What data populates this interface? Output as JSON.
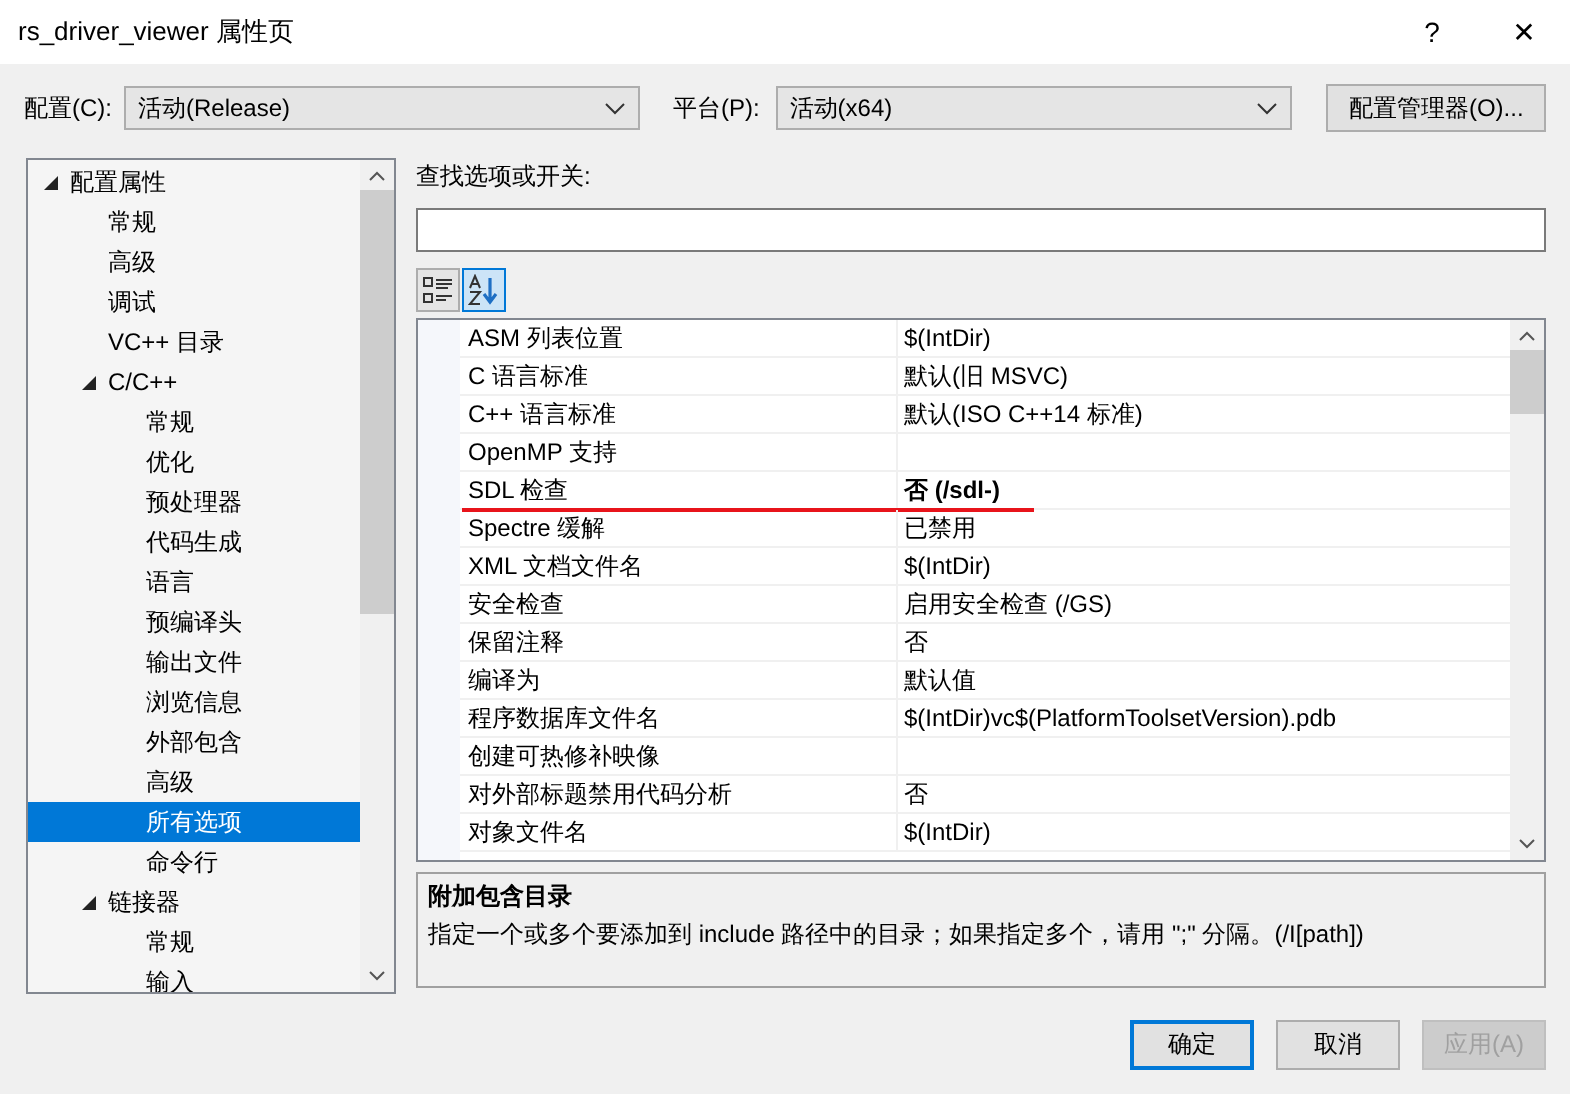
{
  "window": {
    "title": "rs_driver_viewer 属性页",
    "help": "?",
    "close": "✕"
  },
  "config": {
    "label": "配置(C):",
    "value": "活动(Release)"
  },
  "platform": {
    "label": "平台(P):",
    "value": "活动(x64)"
  },
  "config_manager": "配置管理器(O)...",
  "tree": [
    {
      "label": "配置属性",
      "expanded": true,
      "selected": false,
      "children": [
        {
          "label": "常规",
          "selected": false
        },
        {
          "label": "高级",
          "selected": false
        },
        {
          "label": "调试",
          "selected": false
        },
        {
          "label": "VC++ 目录",
          "selected": false
        },
        {
          "label": "C/C++",
          "expanded": true,
          "selected": false,
          "children": [
            {
              "label": "常规",
              "selected": false
            },
            {
              "label": "优化",
              "selected": false
            },
            {
              "label": "预处理器",
              "selected": false
            },
            {
              "label": "代码生成",
              "selected": false
            },
            {
              "label": "语言",
              "selected": false
            },
            {
              "label": "预编译头",
              "selected": false
            },
            {
              "label": "输出文件",
              "selected": false
            },
            {
              "label": "浏览信息",
              "selected": false
            },
            {
              "label": "外部包含",
              "selected": false
            },
            {
              "label": "高级",
              "selected": false
            },
            {
              "label": "所有选项",
              "selected": true
            },
            {
              "label": "命令行",
              "selected": false
            }
          ]
        },
        {
          "label": "链接器",
          "expanded": true,
          "selected": false,
          "children": [
            {
              "label": "常规",
              "selected": false
            },
            {
              "label": "输入",
              "selected": false
            }
          ]
        }
      ]
    }
  ],
  "search": {
    "label": "查找选项或开关:"
  },
  "view_buttons": [
    {
      "kind": "categorized",
      "selected": false
    },
    {
      "kind": "alphabetical",
      "selected": true
    }
  ],
  "properties": [
    {
      "name": "ASM 列表位置",
      "value": "$(IntDir)",
      "modified": false,
      "underlined": false
    },
    {
      "name": "C 语言标准",
      "value": "默认(旧 MSVC)",
      "modified": false,
      "underlined": false
    },
    {
      "name": "C++ 语言标准",
      "value": "默认(ISO C++14 标准)",
      "modified": false,
      "underlined": false
    },
    {
      "name": "OpenMP 支持",
      "underlined": false
    },
    {
      "name": "SDL 检查",
      "value": "否 (/sdl-)",
      "modified": true,
      "underlined": true
    },
    {
      "name": "Spectre 缓解",
      "value": "已禁用",
      "modified": false,
      "underlined": false
    },
    {
      "name": "XML 文档文件名",
      "value": "$(IntDir)",
      "modified": false,
      "underlined": false
    },
    {
      "name": "安全检查",
      "value": "启用安全检查 (/GS)",
      "modified": false,
      "underlined": false
    },
    {
      "name": "保留注释",
      "value": "否",
      "modified": false,
      "underlined": false
    },
    {
      "name": "编译为",
      "value": "默认值",
      "modified": false,
      "underlined": false
    },
    {
      "name": "程序数据库文件名",
      "value": "$(IntDir)vc$(PlatformToolsetVersion).pdb",
      "modified": false,
      "underlined": false
    },
    {
      "name": "创建可热修补映像",
      "underlined": false
    },
    {
      "name": "对外部标题禁用代码分析",
      "value": "否",
      "modified": false,
      "underlined": false
    },
    {
      "name": "对象文件名",
      "value": "$(IntDir)",
      "modified": false,
      "underlined": false
    }
  ],
  "description": {
    "title": "附加包含目录",
    "text": "指定一个或多个要添加到 include 路径中的目录；如果指定多个，请用 \";\" 分隔。(/I[path])"
  },
  "buttons": [
    {
      "label": "确定",
      "default": true,
      "disabled": false
    },
    {
      "label": "取消",
      "default": false,
      "disabled": false
    },
    {
      "label": "应用(A)",
      "default": false,
      "disabled": true
    }
  ]
}
